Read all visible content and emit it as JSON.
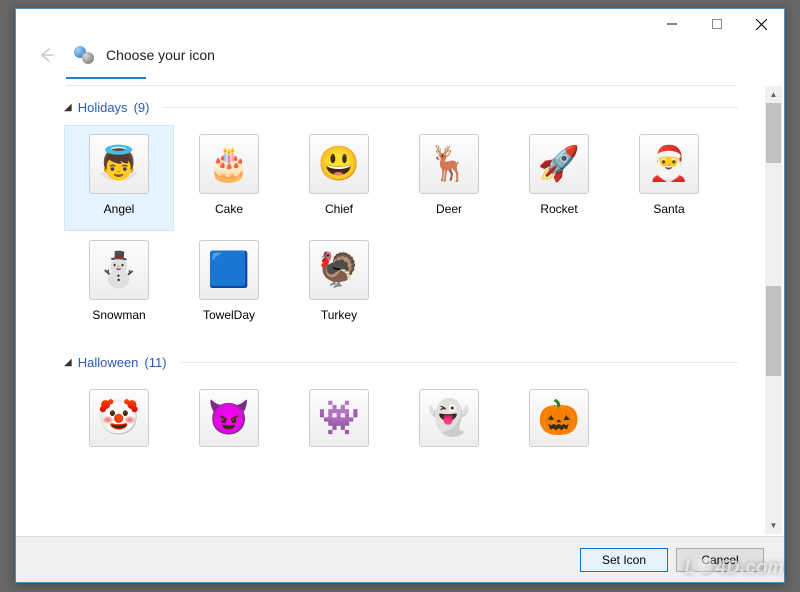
{
  "window": {
    "title": "Choose your icon"
  },
  "categories": [
    {
      "name": "Holidays",
      "count": 9,
      "items": [
        {
          "label": "Angel",
          "emoji": "👼",
          "selected": true
        },
        {
          "label": "Cake",
          "emoji": "🎂",
          "selected": false
        },
        {
          "label": "Chief",
          "emoji": "😃",
          "selected": false
        },
        {
          "label": "Deer",
          "emoji": "🦌",
          "selected": false
        },
        {
          "label": "Rocket",
          "emoji": "🚀",
          "selected": false
        },
        {
          "label": "Santa",
          "emoji": "🎅",
          "selected": false
        },
        {
          "label": "Snowman",
          "emoji": "⛄",
          "selected": false
        },
        {
          "label": "TowelDay",
          "emoji": "🟦",
          "selected": false
        },
        {
          "label": "Turkey",
          "emoji": "🦃",
          "selected": false
        }
      ]
    },
    {
      "name": "Halloween",
      "count": 11,
      "items": [
        {
          "label": "",
          "emoji": "🤡",
          "selected": false
        },
        {
          "label": "",
          "emoji": "😈",
          "selected": false
        },
        {
          "label": "",
          "emoji": "👾",
          "selected": false
        },
        {
          "label": "",
          "emoji": "👻",
          "selected": false
        },
        {
          "label": "",
          "emoji": "🎃",
          "selected": false
        }
      ]
    }
  ],
  "buttons": {
    "primary": "Set Icon",
    "secondary": "Cancel"
  },
  "watermark": "L4D.com"
}
